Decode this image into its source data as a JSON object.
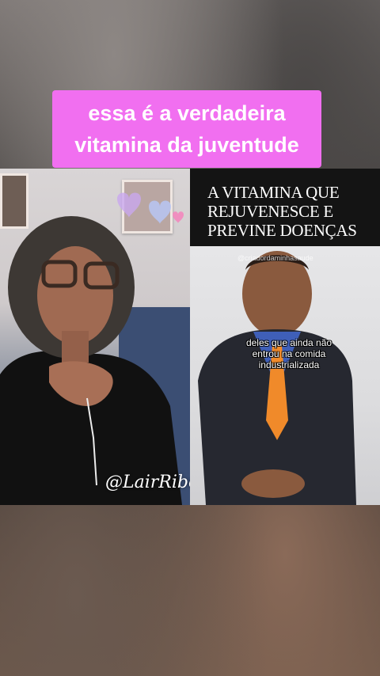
{
  "caption": {
    "line1": "essa é a verdadeira",
    "line2": "vitamina da juventude"
  },
  "right_video": {
    "title_lines": [
      "A VITAMINA QUE",
      "REJUVENESCE E",
      "PREVINE DOENÇAS"
    ],
    "watermark": "@criadordaminhasaude",
    "subtitle_lines": [
      "deles que ainda não",
      "entrou na comida",
      "industrializada"
    ]
  },
  "signature": "@LairRibeiro",
  "colors": {
    "caption_bg": "#f16ff0",
    "title_bg": "#141414",
    "shirt": "#3f5fb8",
    "tie": "#f08a2a"
  }
}
